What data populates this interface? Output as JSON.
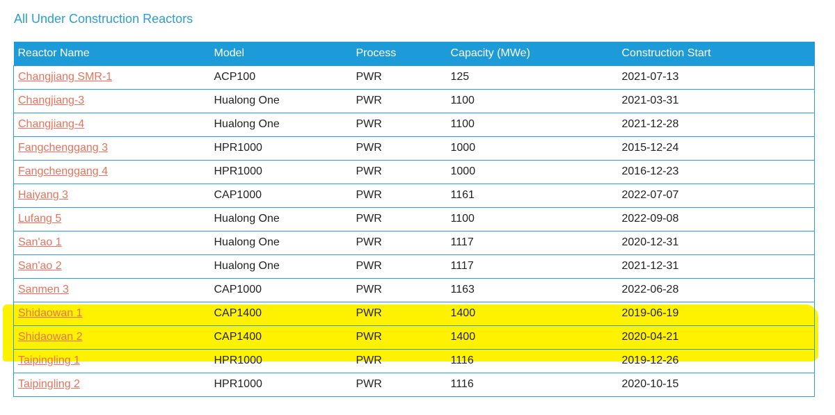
{
  "page": {
    "title": "All Under Construction Reactors"
  },
  "table": {
    "headers": [
      "Reactor Name",
      "Model",
      "Process",
      "Capacity (MWe)",
      "Construction Start"
    ],
    "rows": [
      {
        "name": "Changjiang SMR-1",
        "model": "ACP100",
        "process": "PWR",
        "capacity": "125",
        "start": "2021-07-13",
        "highlighted": false
      },
      {
        "name": "Changjiang-3",
        "model": "Hualong One",
        "process": "PWR",
        "capacity": "1100",
        "start": "2021-03-31",
        "highlighted": false
      },
      {
        "name": "Changjiang-4",
        "model": "Hualong One",
        "process": "PWR",
        "capacity": "1100",
        "start": "2021-12-28",
        "highlighted": false
      },
      {
        "name": "Fangchenggang 3",
        "model": "HPR1000",
        "process": "PWR",
        "capacity": "1000",
        "start": "2015-12-24",
        "highlighted": false
      },
      {
        "name": "Fangchenggang 4",
        "model": "HPR1000",
        "process": "PWR",
        "capacity": "1000",
        "start": "2016-12-23",
        "highlighted": false
      },
      {
        "name": "Haiyang 3",
        "model": "CAP1000",
        "process": "PWR",
        "capacity": "1161",
        "start": "2022-07-07",
        "highlighted": false
      },
      {
        "name": "Lufang 5",
        "model": "Hualong One",
        "process": "PWR",
        "capacity": "1100",
        "start": "2022-09-08",
        "highlighted": false
      },
      {
        "name": "San'ao 1",
        "model": "Hualong One",
        "process": "PWR",
        "capacity": "1117",
        "start": "2020-12-31",
        "highlighted": false
      },
      {
        "name": "San'ao 2",
        "model": "Hualong One",
        "process": "PWR",
        "capacity": "1117",
        "start": "2021-12-31",
        "highlighted": false
      },
      {
        "name": "Sanmen 3",
        "model": "CAP1000",
        "process": "PWR",
        "capacity": "1163",
        "start": "2022-06-28",
        "highlighted": false
      },
      {
        "name": "Shidaowan 1",
        "model": "CAP1400",
        "process": "PWR",
        "capacity": "1400",
        "start": "2019-06-19",
        "highlighted": true
      },
      {
        "name": "Shidaowan 2",
        "model": "CAP1400",
        "process": "PWR",
        "capacity": "1400",
        "start": "2020-04-21",
        "highlighted": true
      },
      {
        "name": "Taipingling 1",
        "model": "HPR1000",
        "process": "PWR",
        "capacity": "1116",
        "start": "2019-12-26",
        "highlighted": false
      },
      {
        "name": "Taipingling 2",
        "model": "HPR1000",
        "process": "PWR",
        "capacity": "1116",
        "start": "2020-10-15",
        "highlighted": false
      }
    ]
  },
  "colors": {
    "accent": "#1d9bd8",
    "link": "#e8735a",
    "highlight": "#fff200"
  }
}
